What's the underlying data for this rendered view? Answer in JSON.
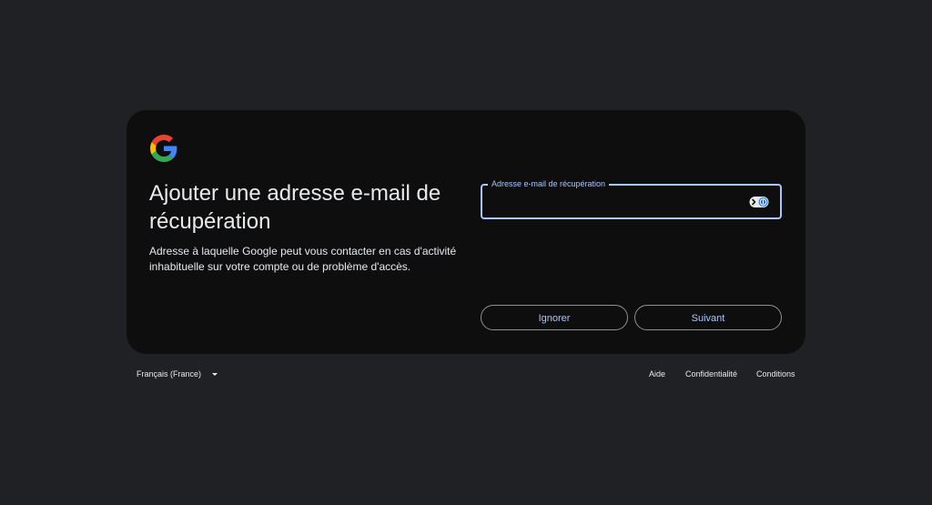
{
  "card": {
    "title": "Ajouter une adresse e-mail de récupération",
    "subtitle": "Adresse à laquelle Google peut vous contacter en cas d'activité inhabituelle sur votre compte ou de problème d'accès."
  },
  "logo": {
    "icon": "google-g-logo",
    "colors": [
      "#4285f4",
      "#ea4335",
      "#fbbc05",
      "#34a853"
    ]
  },
  "email_field": {
    "label": "Adresse e-mail de récupération",
    "value": "",
    "accent_color": "#a8c7fa",
    "trailing_icon": "password-manager-icon"
  },
  "buttons": {
    "skip_label": "Ignorer",
    "next_label": "Suivant"
  },
  "footer": {
    "language": "Français (France)",
    "help": "Aide",
    "privacy": "Confidentialité",
    "terms": "Conditions"
  }
}
